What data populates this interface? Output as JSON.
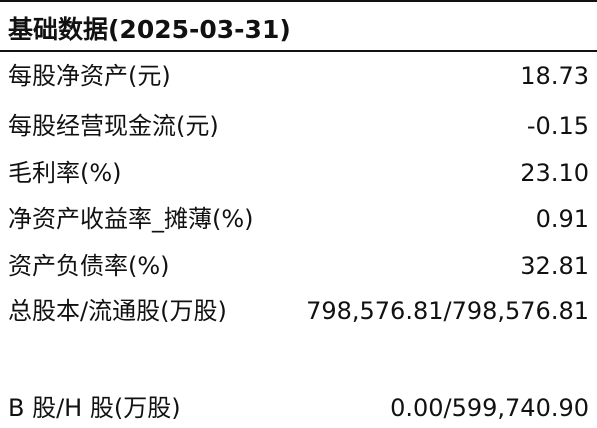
{
  "section": {
    "title": "基础数据(2025-03-31)"
  },
  "rows": [
    {
      "label": "每股净资产(元)",
      "value": "18.73"
    },
    {
      "label": "每股经营现金流(元)",
      "value": "-0.15"
    },
    {
      "label": "毛利率(%)",
      "value": "23.10"
    },
    {
      "label": "净资产收益率_摊薄(%)",
      "value": "0.91"
    },
    {
      "label": "资产负债率(%)",
      "value": "32.81"
    },
    {
      "label": "总股本/流通股(万股)",
      "value": "798,576.81/798,576.81"
    },
    {
      "label": "B 股/H 股(万股)",
      "value": "0.00/599,740.90"
    }
  ]
}
